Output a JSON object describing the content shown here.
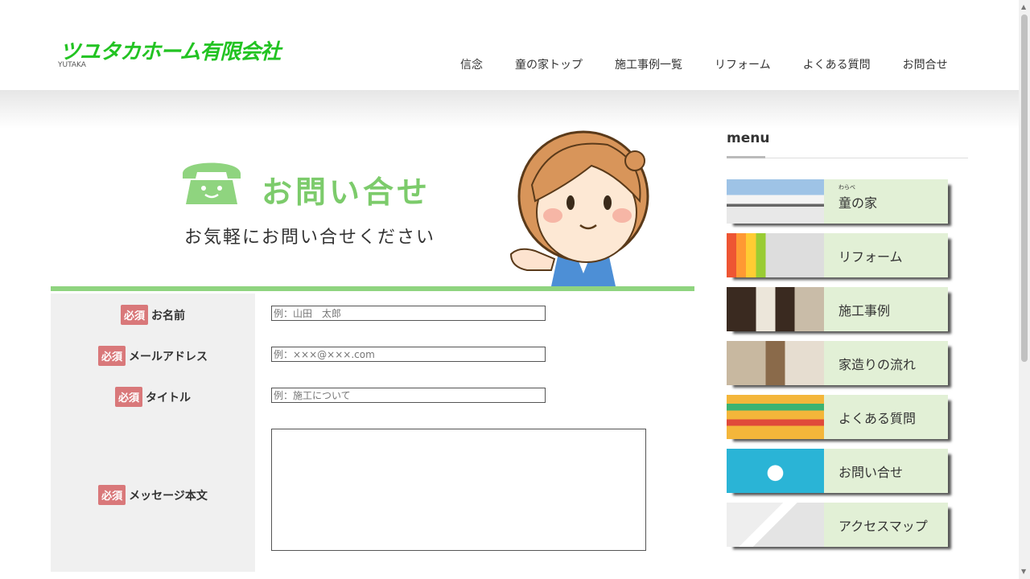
{
  "header": {
    "logo_text": "ツユタカホーム有限会社",
    "logo_sub": "YUTAKA",
    "nav": [
      "信念",
      "童の家トップ",
      "施工事例一覧",
      "リフォーム",
      "よくある質問",
      "お問合せ"
    ]
  },
  "hero": {
    "title": "お問い合せ",
    "subtitle": "お気軽にお問い合せください"
  },
  "form": {
    "required_badge": "必須",
    "fields": [
      {
        "label": "お名前",
        "placeholder": "例：山田　太郎"
      },
      {
        "label": "メールアドレス",
        "placeholder": "例：×××@×××.com"
      },
      {
        "label": "タイトル",
        "placeholder": "例：施工について"
      },
      {
        "label": "メッセージ本文",
        "placeholder": ""
      }
    ]
  },
  "sidebar": {
    "title": "menu",
    "items": [
      {
        "label": "童の家",
        "ruby": "わらべ"
      },
      {
        "label": "リフォーム"
      },
      {
        "label": "施工事例"
      },
      {
        "label": "家造りの流れ"
      },
      {
        "label": "よくある質問"
      },
      {
        "label": "お問い合せ"
      },
      {
        "label": "アクセスマップ"
      }
    ]
  },
  "colors": {
    "brand_green": "#22c322",
    "hero_green": "#7ccb6b",
    "required_red": "#d9787a",
    "menu_bg": "#e2f0d6"
  }
}
